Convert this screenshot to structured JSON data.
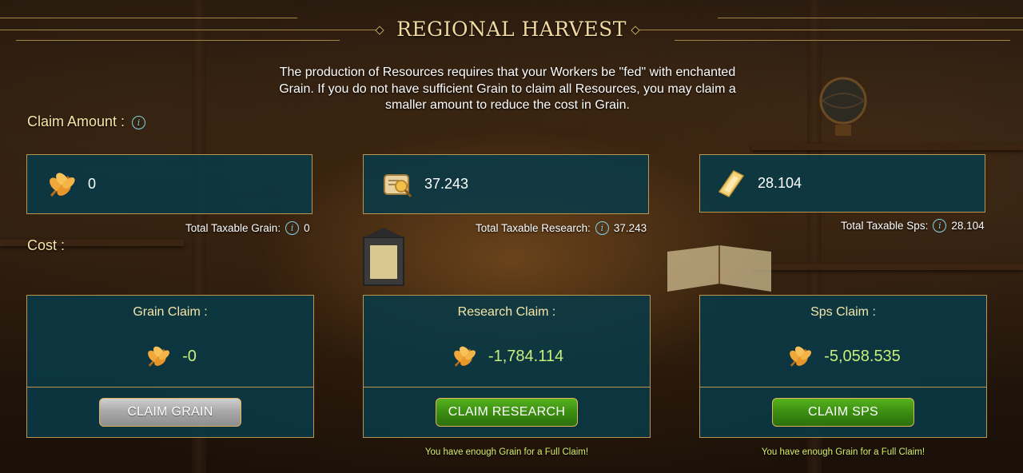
{
  "header": {
    "title": "REGIONAL HARVEST"
  },
  "description": "The production of Resources requires that your Workers be \"fed\" with enchanted Grain. If you do not have sufficient Grain to claim all Resources, you may claim a smaller amount to reduce the cost in Grain.",
  "claim_amount": {
    "label": "Claim Amount :",
    "info_icon": "info-icon",
    "fields": [
      {
        "icon": "grain-icon",
        "value": "0",
        "taxable_label": "Total Taxable Grain:",
        "taxable_value": "0"
      },
      {
        "icon": "research-scroll-icon",
        "value": "37.243",
        "taxable_label": "Total Taxable Research:",
        "taxable_value": "37.243"
      },
      {
        "icon": "sps-crystal-icon",
        "value": "28.104",
        "taxable_label": "Total Taxable Sps:",
        "taxable_value": "28.104"
      }
    ]
  },
  "cost": {
    "label": "Cost :",
    "cards": [
      {
        "title": "Grain Claim :",
        "value": "-0",
        "button": "CLAIM GRAIN",
        "button_state": "disabled",
        "message": ""
      },
      {
        "title": "Research Claim :",
        "value": "-1,784.114",
        "button": "CLAIM RESEARCH",
        "button_state": "enabled",
        "message": "You have enough Grain for a Full Claim!"
      },
      {
        "title": "Sps Claim :",
        "value": "-5,058.535",
        "button": "CLAIM SPS",
        "button_state": "enabled",
        "message": "You have enough Grain for a Full Claim!"
      }
    ]
  },
  "colors": {
    "panel": "#083a48",
    "border_gold": "#b8964e",
    "label_yellow": "#f5e6a8",
    "cost_green": "#c6f07a",
    "button_green": "#3b8d12",
    "info_blue": "#7fd3e6"
  }
}
